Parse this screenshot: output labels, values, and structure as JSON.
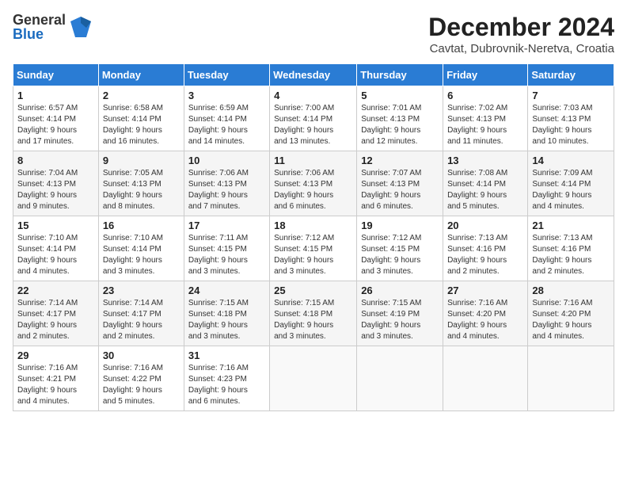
{
  "logo": {
    "general": "General",
    "blue": "Blue"
  },
  "title": "December 2024",
  "location": "Cavtat, Dubrovnik-Neretva, Croatia",
  "headers": [
    "Sunday",
    "Monday",
    "Tuesday",
    "Wednesday",
    "Thursday",
    "Friday",
    "Saturday"
  ],
  "weeks": [
    [
      {
        "day": "1",
        "info": "Sunrise: 6:57 AM\nSunset: 4:14 PM\nDaylight: 9 hours\nand 17 minutes."
      },
      {
        "day": "2",
        "info": "Sunrise: 6:58 AM\nSunset: 4:14 PM\nDaylight: 9 hours\nand 16 minutes."
      },
      {
        "day": "3",
        "info": "Sunrise: 6:59 AM\nSunset: 4:14 PM\nDaylight: 9 hours\nand 14 minutes."
      },
      {
        "day": "4",
        "info": "Sunrise: 7:00 AM\nSunset: 4:14 PM\nDaylight: 9 hours\nand 13 minutes."
      },
      {
        "day": "5",
        "info": "Sunrise: 7:01 AM\nSunset: 4:13 PM\nDaylight: 9 hours\nand 12 minutes."
      },
      {
        "day": "6",
        "info": "Sunrise: 7:02 AM\nSunset: 4:13 PM\nDaylight: 9 hours\nand 11 minutes."
      },
      {
        "day": "7",
        "info": "Sunrise: 7:03 AM\nSunset: 4:13 PM\nDaylight: 9 hours\nand 10 minutes."
      }
    ],
    [
      {
        "day": "8",
        "info": "Sunrise: 7:04 AM\nSunset: 4:13 PM\nDaylight: 9 hours\nand 9 minutes."
      },
      {
        "day": "9",
        "info": "Sunrise: 7:05 AM\nSunset: 4:13 PM\nDaylight: 9 hours\nand 8 minutes."
      },
      {
        "day": "10",
        "info": "Sunrise: 7:06 AM\nSunset: 4:13 PM\nDaylight: 9 hours\nand 7 minutes."
      },
      {
        "day": "11",
        "info": "Sunrise: 7:06 AM\nSunset: 4:13 PM\nDaylight: 9 hours\nand 6 minutes."
      },
      {
        "day": "12",
        "info": "Sunrise: 7:07 AM\nSunset: 4:13 PM\nDaylight: 9 hours\nand 6 minutes."
      },
      {
        "day": "13",
        "info": "Sunrise: 7:08 AM\nSunset: 4:14 PM\nDaylight: 9 hours\nand 5 minutes."
      },
      {
        "day": "14",
        "info": "Sunrise: 7:09 AM\nSunset: 4:14 PM\nDaylight: 9 hours\nand 4 minutes."
      }
    ],
    [
      {
        "day": "15",
        "info": "Sunrise: 7:10 AM\nSunset: 4:14 PM\nDaylight: 9 hours\nand 4 minutes."
      },
      {
        "day": "16",
        "info": "Sunrise: 7:10 AM\nSunset: 4:14 PM\nDaylight: 9 hours\nand 3 minutes."
      },
      {
        "day": "17",
        "info": "Sunrise: 7:11 AM\nSunset: 4:15 PM\nDaylight: 9 hours\nand 3 minutes."
      },
      {
        "day": "18",
        "info": "Sunrise: 7:12 AM\nSunset: 4:15 PM\nDaylight: 9 hours\nand 3 minutes."
      },
      {
        "day": "19",
        "info": "Sunrise: 7:12 AM\nSunset: 4:15 PM\nDaylight: 9 hours\nand 3 minutes."
      },
      {
        "day": "20",
        "info": "Sunrise: 7:13 AM\nSunset: 4:16 PM\nDaylight: 9 hours\nand 2 minutes."
      },
      {
        "day": "21",
        "info": "Sunrise: 7:13 AM\nSunset: 4:16 PM\nDaylight: 9 hours\nand 2 minutes."
      }
    ],
    [
      {
        "day": "22",
        "info": "Sunrise: 7:14 AM\nSunset: 4:17 PM\nDaylight: 9 hours\nand 2 minutes."
      },
      {
        "day": "23",
        "info": "Sunrise: 7:14 AM\nSunset: 4:17 PM\nDaylight: 9 hours\nand 2 minutes."
      },
      {
        "day": "24",
        "info": "Sunrise: 7:15 AM\nSunset: 4:18 PM\nDaylight: 9 hours\nand 3 minutes."
      },
      {
        "day": "25",
        "info": "Sunrise: 7:15 AM\nSunset: 4:18 PM\nDaylight: 9 hours\nand 3 minutes."
      },
      {
        "day": "26",
        "info": "Sunrise: 7:15 AM\nSunset: 4:19 PM\nDaylight: 9 hours\nand 3 minutes."
      },
      {
        "day": "27",
        "info": "Sunrise: 7:16 AM\nSunset: 4:20 PM\nDaylight: 9 hours\nand 4 minutes."
      },
      {
        "day": "28",
        "info": "Sunrise: 7:16 AM\nSunset: 4:20 PM\nDaylight: 9 hours\nand 4 minutes."
      }
    ],
    [
      {
        "day": "29",
        "info": "Sunrise: 7:16 AM\nSunset: 4:21 PM\nDaylight: 9 hours\nand 4 minutes."
      },
      {
        "day": "30",
        "info": "Sunrise: 7:16 AM\nSunset: 4:22 PM\nDaylight: 9 hours\nand 5 minutes."
      },
      {
        "day": "31",
        "info": "Sunrise: 7:16 AM\nSunset: 4:23 PM\nDaylight: 9 hours\nand 6 minutes."
      },
      {
        "day": "",
        "info": ""
      },
      {
        "day": "",
        "info": ""
      },
      {
        "day": "",
        "info": ""
      },
      {
        "day": "",
        "info": ""
      }
    ]
  ]
}
